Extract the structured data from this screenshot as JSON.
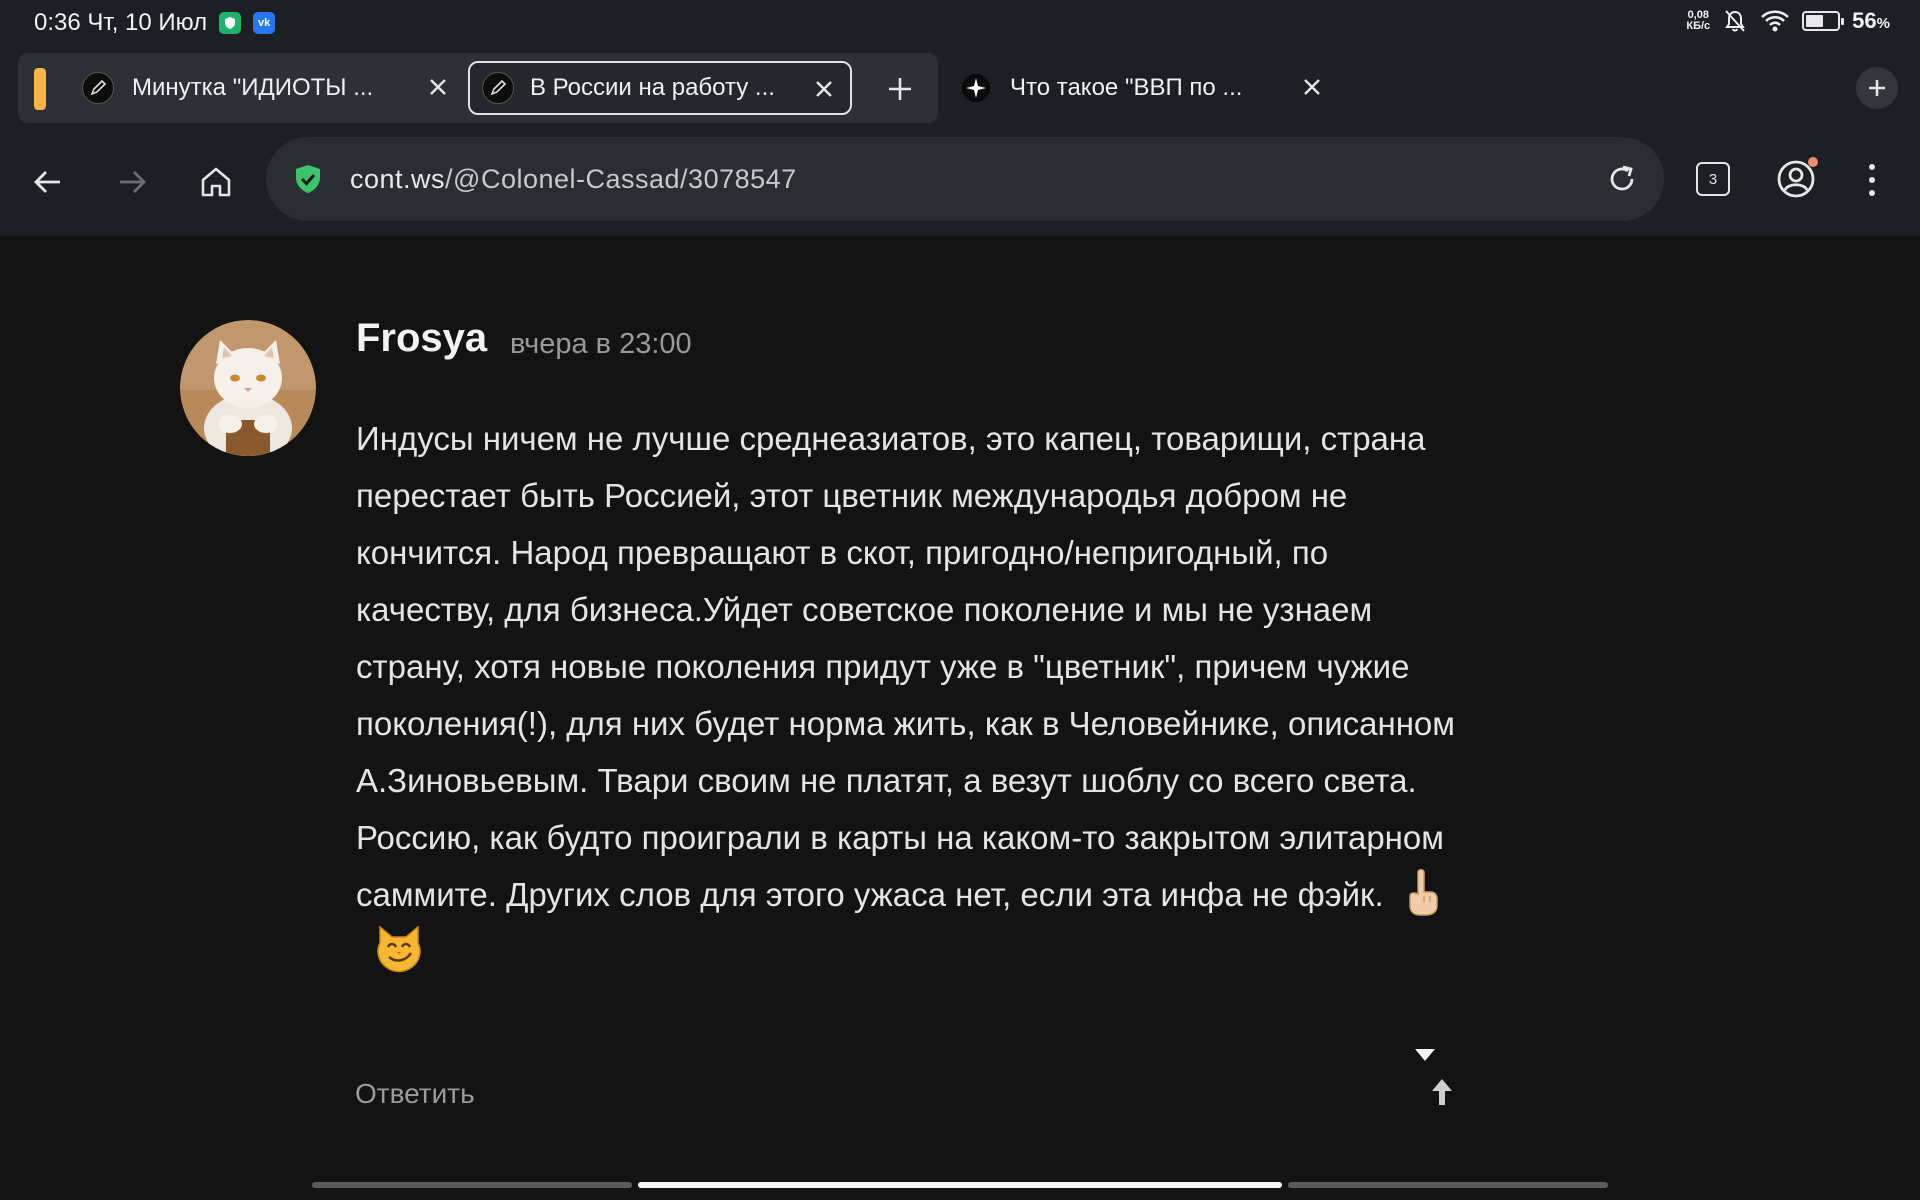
{
  "status_bar": {
    "time_date": "0:36 Чт, 10 Июл",
    "vk_label": "vk",
    "net_speed_value": "0,08",
    "net_speed_unit": "КБ/с",
    "battery_percent": "56",
    "battery_unit": "%",
    "battery_level": 0.56
  },
  "tabs": {
    "group_color": "#f6b545",
    "items": [
      {
        "title": "Минутка \"ИДИОТЫ ...",
        "favicon": "pen-favicon-icon",
        "active": false
      },
      {
        "title": "В России на работу ...",
        "favicon": "pen-favicon-icon",
        "active": true
      },
      {
        "title": "Что такое \"ВВП по ...",
        "favicon": "sparkle-icon",
        "active": false
      }
    ]
  },
  "toolbar": {
    "url_host": "cont.ws",
    "url_path": "/@Colonel-Cassad/3078547",
    "tab_count": "3",
    "secure_color": "#3cc46a"
  },
  "comment": {
    "author": "Frosya",
    "timestamp": "вчера в 23:00",
    "text": "Индусы ничем не лучше среднеазиатов, это капец, товарищи, страна перестает быть Россией, этот цветник международья добром не кончится. Народ превращают в скот, пригодно/непригодный, по качеству, для бизнеса.Уйдет советское поколение и мы не узнаем страну, хотя новые поколения придут уже в \"цветник\", причем чужие поколения(!), для них будет норма жить, как в Человейнике, описанном А.Зиновьевым. Твари своим не платят, а везут шоблу со всего света. Россию, как будто проиграли в карты на каком-то закрытом элитарном саммите. Других слов для этого ужаса нет, если эта инфа не фэйк.",
    "emojis": [
      "index-pointing-up-emoji",
      "smirking-cat-emoji"
    ],
    "reply_label": "Ответить"
  }
}
